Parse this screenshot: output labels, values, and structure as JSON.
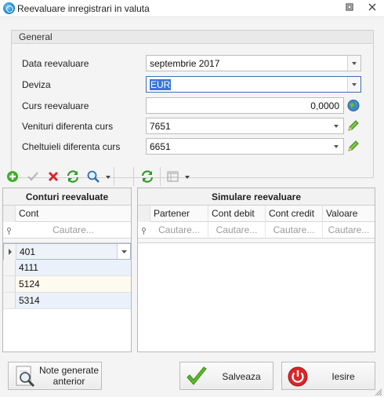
{
  "window": {
    "title": "Reevaluare inregistrari in valuta"
  },
  "general": {
    "title": "General",
    "data_reevaluare": {
      "label": "Data reevaluare",
      "value": "septembrie 2017"
    },
    "deviza": {
      "label": "Deviza",
      "value": "EUR"
    },
    "curs": {
      "label": "Curs reevaluare",
      "value": "0,0000"
    },
    "venituri": {
      "label": "Venituri diferenta curs",
      "value": "7651"
    },
    "cheltuieli": {
      "label": "Cheltuieli diferenta curs",
      "value": "6651"
    }
  },
  "left_panel": {
    "title": "Conturi reevaluate",
    "column": "Cont",
    "search_placeholder": "Cautare...",
    "rows": [
      "401",
      "4111",
      "5124",
      "5314"
    ]
  },
  "right_panel": {
    "title": "Simulare reevaluare",
    "columns": [
      "Partener",
      "Cont debit",
      "Cont credit",
      "Valoare"
    ],
    "search_placeholder": "Cautare..."
  },
  "buttons": {
    "note_line1": "Note generate",
    "note_line2": "anterior",
    "save": "Salveaza",
    "exit": "Iesire"
  },
  "colors": {
    "accent": "#3875d7",
    "save_check": "#5cb82a",
    "exit_red": "#d9262b"
  }
}
